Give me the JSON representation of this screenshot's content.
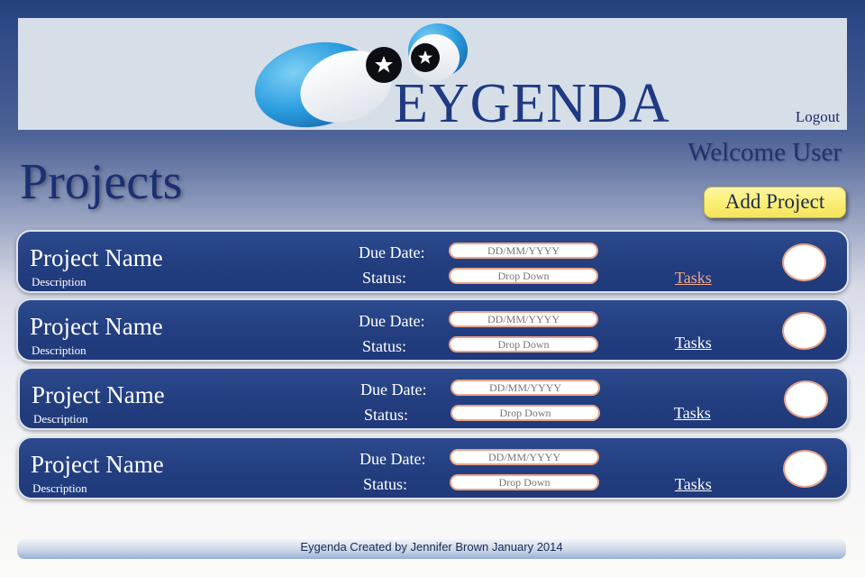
{
  "header": {
    "logo_text": "EYGENDA",
    "logout_label": "Logout"
  },
  "welcome_text": "Welcome User",
  "page_title": "Projects",
  "add_project_label": "Add Project",
  "projects": [
    {
      "name": "Project Name",
      "description": "Description",
      "due_label": "Due Date:",
      "due_placeholder": "DD/MM/YYYY",
      "status_label": "Status:",
      "status_placeholder": "Drop Down",
      "tasks_label": "Tasks"
    },
    {
      "name": "Project Name",
      "description": "Description",
      "due_label": "Due Date:",
      "due_placeholder": "DD/MM/YYYY",
      "status_label": "Status:",
      "status_placeholder": "Drop Down",
      "tasks_label": "Tasks"
    },
    {
      "name": "Project Name",
      "description": "Description",
      "due_label": "Due Date:",
      "due_placeholder": "DD/MM/YYYY",
      "status_label": "Status:",
      "status_placeholder": "Drop Down",
      "tasks_label": "Tasks"
    },
    {
      "name": "Project Name",
      "description": "Description",
      "due_label": "Due Date:",
      "due_placeholder": "DD/MM/YYYY",
      "status_label": "Status:",
      "status_placeholder": "Drop Down",
      "tasks_label": "Tasks"
    }
  ],
  "footer_text": "Eygenda Created by Jennifer Brown January 2014",
  "colors": {
    "brand_blue": "#1f3a82",
    "card_blue": "#233f80",
    "button_yellow": "#fbf07a",
    "field_border": "#e7a48a",
    "tasks_visited": "#f0a98e"
  }
}
